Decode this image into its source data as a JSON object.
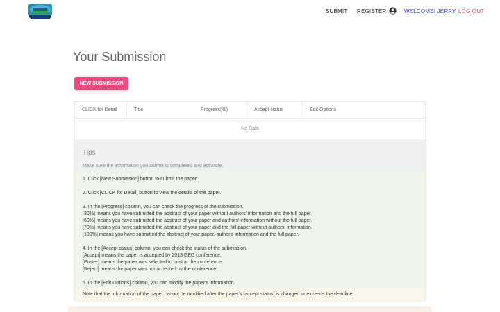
{
  "header": {
    "logo_icon": "conference-logo-icon",
    "nav": {
      "submit": "SUBMIT",
      "register": "REGISTER",
      "user_icon": "user-circle-icon",
      "welcome": "WELCOME! JERRY",
      "logout": "LOG OUT"
    },
    "colors": {
      "welcome": "#3b3fb3",
      "logout": "#e8465f"
    }
  },
  "main": {
    "title": "Your Submission",
    "new_submission_button": "NEW SUBMISSION",
    "button_color": "#e94a7f",
    "table": {
      "columns": [
        "CLICK for Detail",
        "Title",
        "Progress(%)",
        "Accept status",
        "Edit Options"
      ],
      "empty_text": "No Data"
    },
    "tips": {
      "title": "Tips",
      "subtitle": "Make sure the information you submit is completed and accurate.",
      "lines": [
        "1. Click [New Submission] button to submit the paper.",
        "2. Click [CLICK for Detail] button to view the details of the paper.",
        "3. In the [Progress] column, you can check the progress of the submission.",
        "[30%] means you have submitted the abstract of your paper without authors' information and the full paper.",
        "[60%] means you have submitted the abstract of your paper and authors' information without the full paper.",
        "[70%] means you have submitted the abstract of your paper and the full paper without authors' information.",
        "[100%] means you have submitted the abstract of your paper, authors' information and the full paper.",
        "4. In the [Accept status] column, you can check the status of the submission.",
        "[Accept] means the paper is accepted by 2018 GEG conference.",
        "[Poster] means the paper was selected to post at the conference.",
        "[Reject] means the paper was not accepted by the conference.",
        "5. In the [Edit Options] column, you can modify the paper's information."
      ],
      "note": "Note that the information of the paper cannot be modified after the paper's [accept status] is changed or exceeds the deadline."
    }
  }
}
